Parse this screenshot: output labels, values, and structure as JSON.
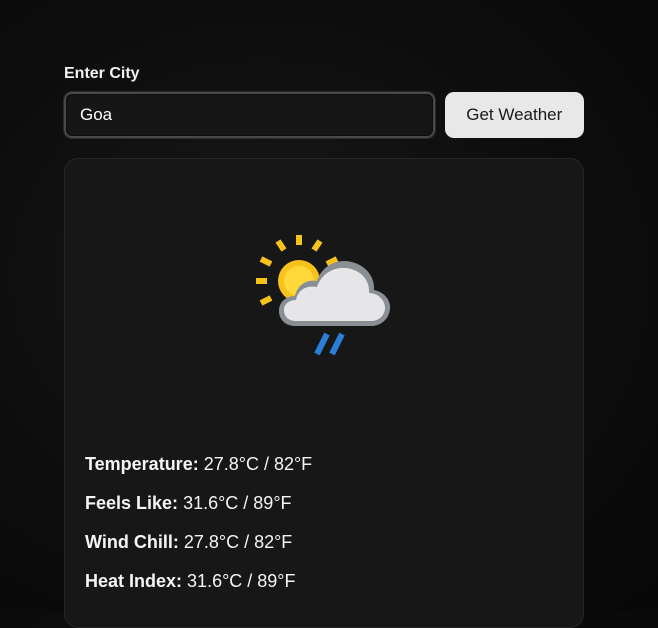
{
  "form": {
    "label": "Enter City",
    "city_value": "Goa",
    "button_label": "Get Weather"
  },
  "weather": {
    "icon": "sun-behind-rain-cloud-icon",
    "details": [
      {
        "label": "Temperature:",
        "value": "27.8°C / 82°F"
      },
      {
        "label": "Feels Like:",
        "value": "31.6°C / 89°F"
      },
      {
        "label": "Wind Chill:",
        "value": "27.8°C / 82°F"
      },
      {
        "label": "Heat Index:",
        "value": "31.6°C / 89°F"
      }
    ]
  },
  "colors": {
    "background": "#0d0d0d",
    "card": "#171717",
    "button": "#e8e8e8",
    "sun": "#f7c21a",
    "rain": "#2b7fd9"
  }
}
